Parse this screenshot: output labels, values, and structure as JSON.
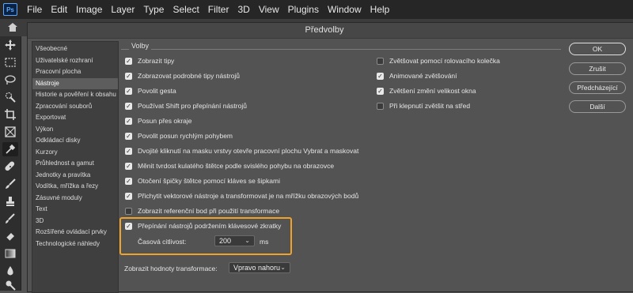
{
  "app": {
    "logo": "Ps",
    "menu": [
      "File",
      "Edit",
      "Image",
      "Layer",
      "Type",
      "Select",
      "Filter",
      "3D",
      "View",
      "Plugins",
      "Window",
      "Help"
    ]
  },
  "dialog": {
    "title": "Předvolby",
    "sidebar": [
      "Všeobecné",
      "Uživatelské rozhraní",
      "Pracovní plocha",
      "Nástroje",
      "Historie a pověření k obsahu",
      "Zpracování souborů",
      "Exportovat",
      "Výkon",
      "Odkládací disky",
      "Kurzory",
      "Průhlednost a gamut",
      "Jednotky a pravítka",
      "Vodítka, mřížka a řezy",
      "Zásuvné moduly",
      "Text",
      "3D",
      "Rozšířené ovládací prvky",
      "Technologické náhledy"
    ],
    "selected_sidebar": "Nástroje",
    "group_title": "Volby",
    "left_options": [
      {
        "label": "Zobrazit tipy",
        "checked": true
      },
      {
        "label": "Zobrazovat podrobné tipy nástrojů",
        "checked": true
      },
      {
        "label": "Povolit gesta",
        "checked": true
      },
      {
        "label": "Používat Shift pro přepínání nástrojů",
        "checked": true
      },
      {
        "label": "Posun přes okraje",
        "checked": true
      },
      {
        "label": "Povolit posun rychlým pohybem",
        "checked": true
      },
      {
        "label": "Dvojité kliknutí na masku vrstvy otevře pracovní plochu Vybrat a maskovat",
        "checked": true
      },
      {
        "label": "Měnit tvrdost kulatého štětce podle svislého pohybu na obrazovce",
        "checked": true
      },
      {
        "label": "Otočení špičky štětce pomocí kláves se šipkami",
        "checked": true
      },
      {
        "label": "Přichytit vektorové nástroje a transformovat je na mřížku obrazových bodů",
        "checked": true
      },
      {
        "label": "Zobrazit referenční bod při použití transformace",
        "checked": false
      }
    ],
    "right_options": [
      {
        "label": "Zvětšovat pomocí rolovacího kolečka",
        "checked": false
      },
      {
        "label": "Animované zvětšování",
        "checked": true
      },
      {
        "label": "Zvětšení změní velikost okna",
        "checked": true
      },
      {
        "label": "Při klepnutí zvětšit na střed",
        "checked": false
      }
    ],
    "spring_loaded": {
      "label": "Přepínání nástrojů podržením klávesové zkratky",
      "checked": true
    },
    "sensitivity": {
      "label": "Časová citlivost:",
      "value": "200",
      "unit": "ms"
    },
    "transform_values": {
      "label": "Zobrazit hodnoty transformace:",
      "value": "Vpravo nahoru"
    },
    "buttons": {
      "ok": "OK",
      "cancel": "Zrušit",
      "prev": "Předcházející",
      "next": "Další"
    }
  },
  "colors": {
    "highlight": "#f0a32a",
    "background": "#535353"
  }
}
